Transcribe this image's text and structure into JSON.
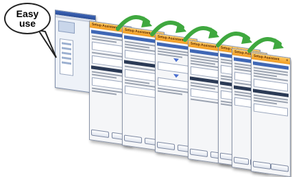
{
  "bubble": {
    "line1": "Easy",
    "line2": "use"
  },
  "dialogs": [
    {
      "title": "Setup Assistant"
    },
    {
      "title": "Setup Assistant"
    },
    {
      "title": "Setup Assistant"
    },
    {
      "title": "Setup Assistant"
    },
    {
      "title": "Setup Assistant"
    },
    {
      "title": "Setup Assistant"
    },
    {
      "title": "Setup Assistant"
    }
  ],
  "colors": {
    "titlebar": "#f29a1e",
    "arrow": "#3fa83f",
    "band": "#3f67b5"
  },
  "icons": [
    "close-icon",
    "green-arrow-icon"
  ]
}
